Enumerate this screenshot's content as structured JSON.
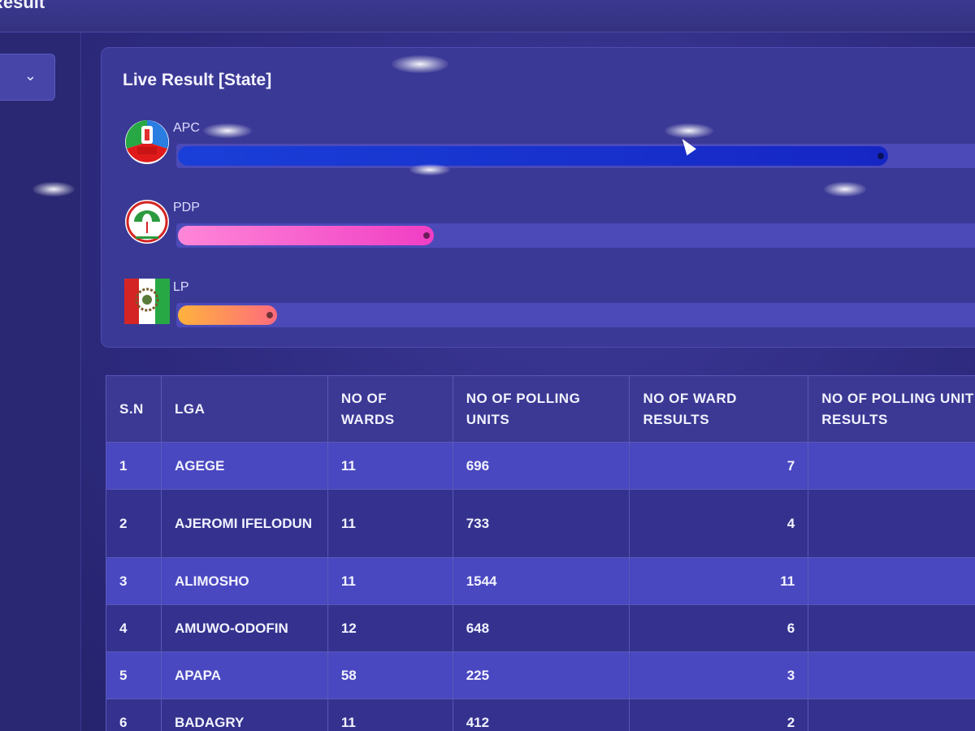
{
  "header": {
    "title": "Result"
  },
  "filter": {
    "icon": "chevron-down-icon"
  },
  "live": {
    "title": "Live Result [State]",
    "parties": [
      {
        "name": "APC",
        "logo": "apc-logo",
        "share": 0.86,
        "color": "#1a36d2"
      },
      {
        "name": "PDP",
        "logo": "pdp-logo",
        "share": 0.31,
        "color": "#f04ac8"
      },
      {
        "name": "LP",
        "logo": "lp-logo",
        "share": 0.12,
        "color": "#ff9a4a"
      }
    ]
  },
  "table": {
    "headers": [
      "S.N",
      "LGA",
      "NO OF WARDS",
      "NO OF POLLING UNITS",
      "NO OF WARD RESULTS",
      "NO OF POLLING UNIT RESULTS"
    ],
    "rows": [
      {
        "sn": "1",
        "lga": "AGEGE",
        "wards": "11",
        "polling_units": "696",
        "ward_results": "7",
        "pu_results": ""
      },
      {
        "sn": "2",
        "lga": "AJEROMI IFELODUN",
        "wards": "11",
        "polling_units": "733",
        "ward_results": "4",
        "pu_results": ""
      },
      {
        "sn": "3",
        "lga": "ALIMOSHO",
        "wards": "11",
        "polling_units": "1544",
        "ward_results": "11",
        "pu_results": ""
      },
      {
        "sn": "4",
        "lga": "AMUWO-ODOFIN",
        "wards": "12",
        "polling_units": "648",
        "ward_results": "6",
        "pu_results": ""
      },
      {
        "sn": "5",
        "lga": "APAPA",
        "wards": "58",
        "polling_units": "225",
        "ward_results": "3",
        "pu_results": ""
      },
      {
        "sn": "6",
        "lga": "BADAGRY",
        "wards": "11",
        "polling_units": "412",
        "ward_results": "2",
        "pu_results": ""
      }
    ]
  }
}
